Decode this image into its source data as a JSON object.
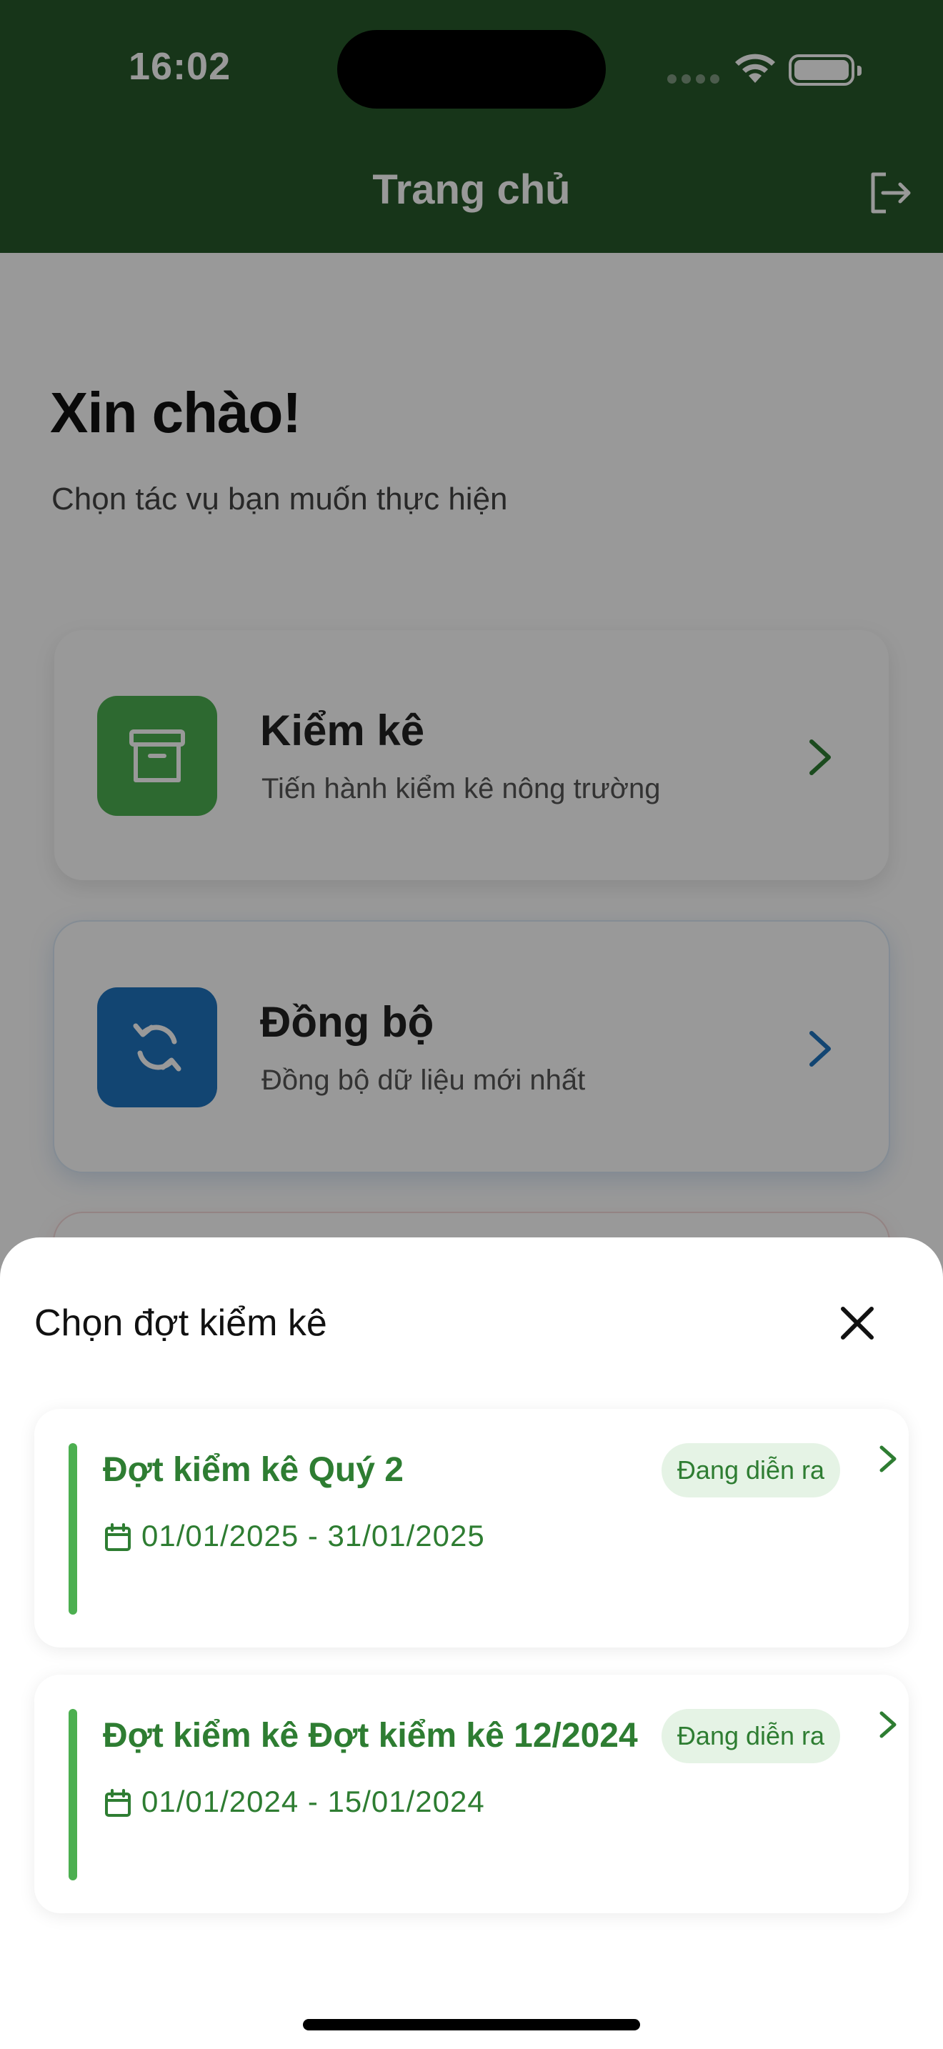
{
  "status_bar": {
    "time": "16:02"
  },
  "app_bar": {
    "title": "Trang chủ",
    "logout_icon": "logout-icon"
  },
  "home": {
    "greeting": "Xin chào!",
    "subtitle": "Chọn tác vụ bạn muốn thực hiện",
    "cards": [
      {
        "title": "Kiểm kê",
        "description": "Tiến hành kiểm kê nông trường",
        "icon": "archive-box-icon",
        "accent": "#4caf50"
      },
      {
        "title": "Đồng bộ",
        "description": "Đồng bộ dữ liệu mới nhất",
        "icon": "sync-icon",
        "accent": "#1e73be"
      }
    ]
  },
  "sheet": {
    "title": "Chọn đợt kiểm kê",
    "close_icon": "close-icon",
    "rounds": [
      {
        "name": "Đợt kiểm kê Quý 2",
        "status": "Đang diễn ra",
        "date_range": "01/01/2025 - 31/01/2025"
      },
      {
        "name": "Đợt kiểm kê Đợt kiểm kê 12/2024",
        "status": "Đang diễn ra",
        "date_range": "01/01/2024 - 15/01/2024"
      }
    ]
  },
  "colors": {
    "app_bar": "#27592a",
    "primary_green": "#2e7d32",
    "accent_bar": "#4caf50",
    "badge_bg": "#e5f3e5",
    "sync_blue": "#1e73be"
  }
}
